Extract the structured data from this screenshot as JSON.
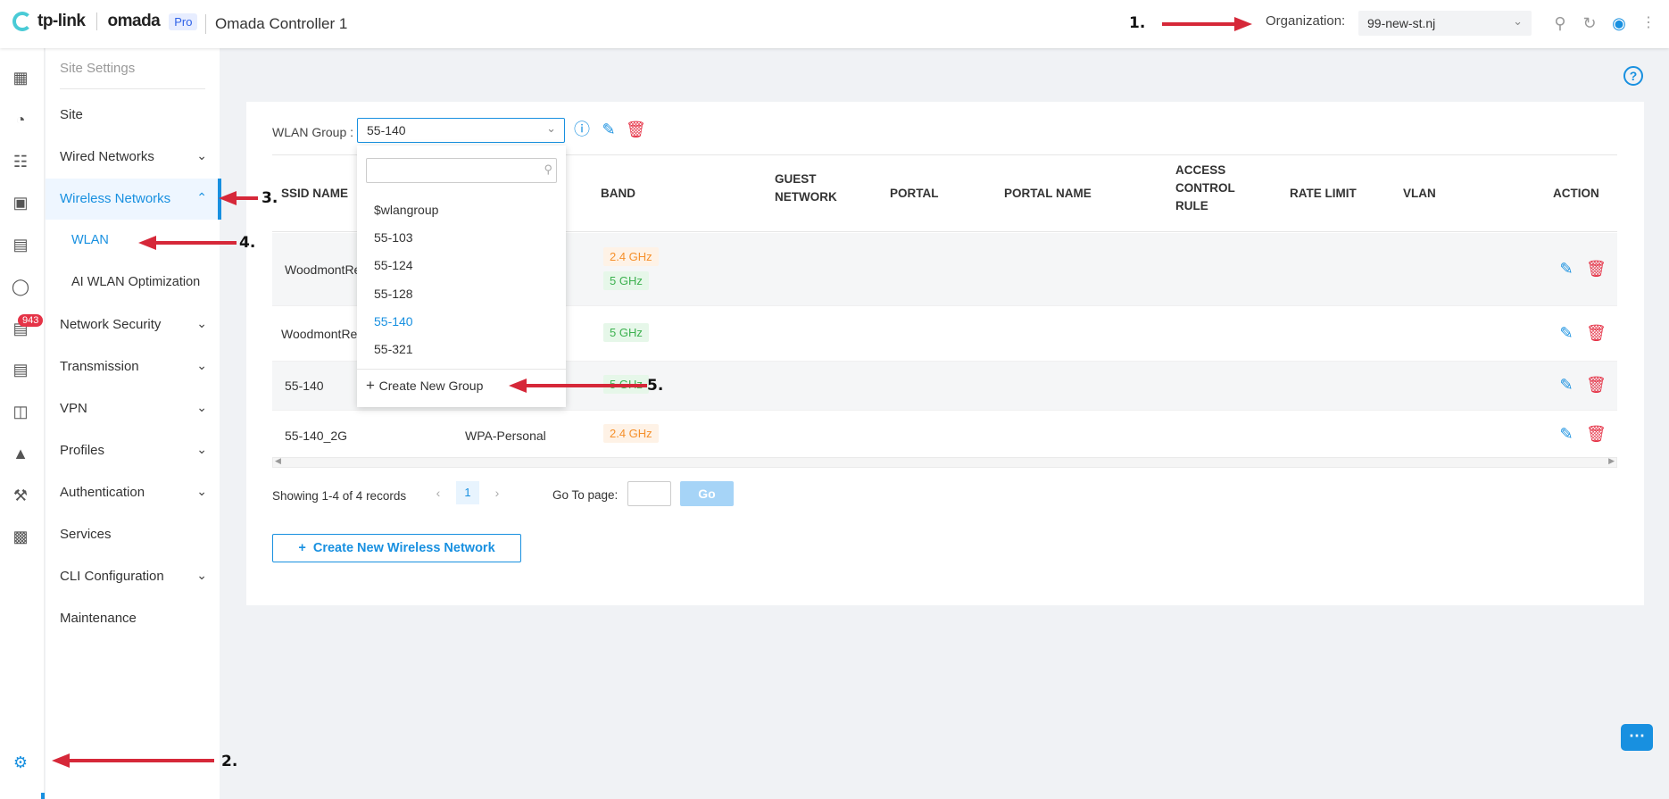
{
  "header": {
    "brand": "tp-link",
    "product": "omada",
    "badge": "Pro",
    "controller_name": "Omada Controller 1",
    "org_label": "Organization:",
    "org_value": "99-new-st.nj"
  },
  "rail": {
    "alert_count": "943",
    "icons": [
      "dashboard-icon",
      "statistics-icon",
      "map-icon",
      "devices-icon",
      "clients-icon",
      "insight-icon",
      "log-icon",
      "report-icon",
      "tools-icon",
      "alarm-icon",
      "maintenance-icon",
      "analytics-icon",
      "settings-icon"
    ]
  },
  "submenu": {
    "heading": "Site Settings",
    "items": [
      {
        "label": "Site"
      },
      {
        "label": "Wired Networks"
      },
      {
        "label": "Wireless Networks"
      },
      {
        "label": "WLAN"
      },
      {
        "label": "AI WLAN Optimization"
      },
      {
        "label": "Network Security"
      },
      {
        "label": "Transmission"
      },
      {
        "label": "VPN"
      },
      {
        "label": "Profiles"
      },
      {
        "label": "Authentication"
      },
      {
        "label": "Services"
      },
      {
        "label": "CLI Configuration"
      },
      {
        "label": "Maintenance"
      }
    ]
  },
  "wlan": {
    "group_label": "WLAN Group :",
    "group_value": "55-140"
  },
  "dropdown": {
    "options": [
      "$wlangroup",
      "55-103",
      "55-124",
      "55-128",
      "55-140",
      "55-321"
    ],
    "selected": "55-140",
    "create_label": "Create New Group"
  },
  "table": {
    "headers": {
      "ssid": "SSID NAME",
      "band": "BAND",
      "guest": "GUEST NETWORK",
      "portal": "PORTAL",
      "portal_name": "PORTAL NAME",
      "acl": "ACCESS CONTROL RULE",
      "rate": "RATE LIMIT",
      "vlan": "VLAN",
      "action": "ACTION"
    },
    "rows": [
      {
        "ssid": "WoodmontRe",
        "security": "",
        "bands": [
          "2.4 GHz",
          "5 GHz"
        ]
      },
      {
        "ssid": "WoodmontRe",
        "security": "",
        "bands": [
          "5 GHz"
        ]
      },
      {
        "ssid": "55-140",
        "security": "",
        "bands": [
          "5 GHz"
        ]
      },
      {
        "ssid": "55-140_2G",
        "security": "WPA-Personal",
        "bands": [
          "2.4 GHz"
        ]
      }
    ]
  },
  "pager": {
    "summary": "Showing 1-4 of 4 records",
    "current_page": "1",
    "goto_label": "Go To page:",
    "go_label": "Go"
  },
  "actions": {
    "create_network": "Create New Wireless Network"
  },
  "annotations": [
    "1.",
    "2.",
    "3.",
    "4.",
    "5."
  ],
  "colors": {
    "accent": "#1890e0",
    "danger": "#e53347",
    "band_24": "#f5902b",
    "band_5": "#3cb14f",
    "arrow": "#d62839"
  }
}
